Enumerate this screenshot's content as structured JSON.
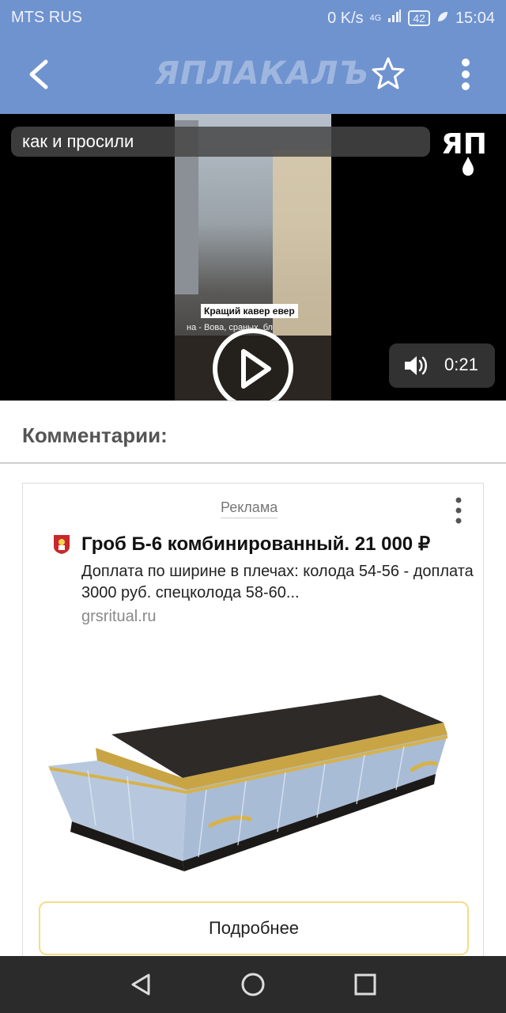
{
  "status_bar": {
    "carrier": "MTS RUS",
    "speed": "0 K/s",
    "network": "4G",
    "battery": "42",
    "time": "15:04"
  },
  "app_bar": {
    "logo_text": "ЯПЛАКАЛЪ"
  },
  "video": {
    "title": "как и просили",
    "overlay_logo": "ЯП",
    "caption": "Кращий кавер евер",
    "subcaption": "на - Вова, сраных, бл",
    "duration": "0:21"
  },
  "comments": {
    "heading": "Комментарии:"
  },
  "ad": {
    "label": "Реклама",
    "title": "Гроб Б-6 комбинированный. 21 000 ₽",
    "description": "Доплата по ширине в плечах: колода 54-56 - доплата 3000 руб. спецколода 58-60...",
    "domain": "grsritual.ru",
    "cta": "Подробнее"
  },
  "colors": {
    "header_blue": "#6f93cf",
    "navbar": "#2b2b2b",
    "cta_border": "#f3dd8a"
  }
}
